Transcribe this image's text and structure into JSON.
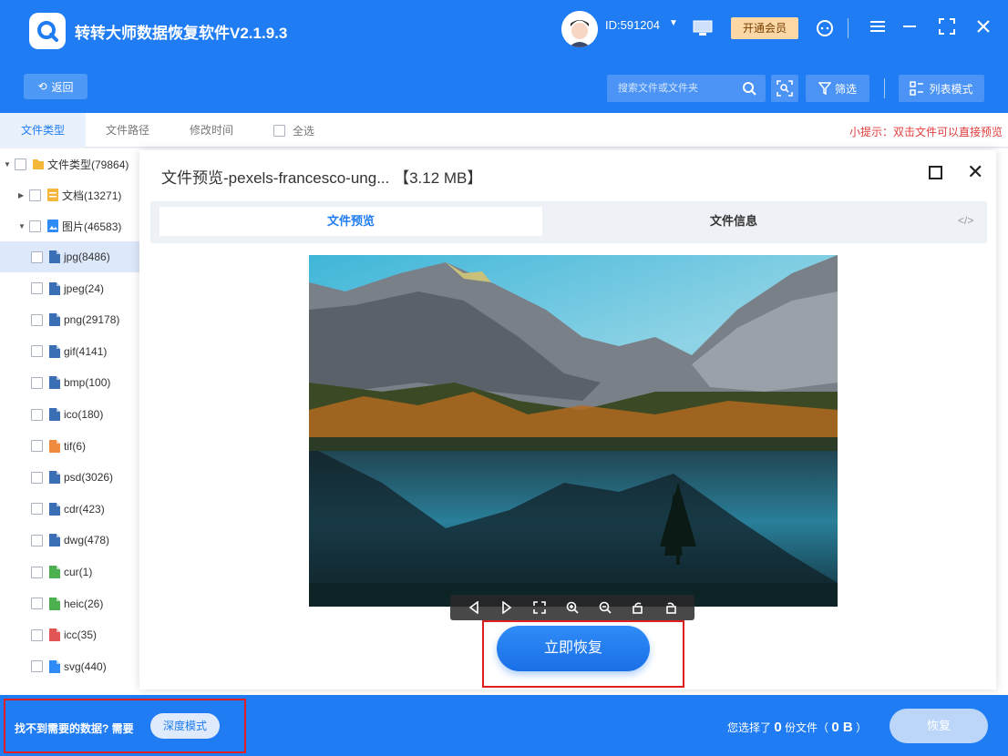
{
  "app": {
    "title": "转转大师数据恢复软件V2.1.9.3",
    "user_id": "ID:591204",
    "vip_label": "开通会员"
  },
  "toolbar": {
    "back_label": "返回",
    "search_placeholder": "搜索文件或文件夹",
    "filter_label": "筛选",
    "list_mode_label": "列表模式"
  },
  "tabs": [
    {
      "label": "文件类型"
    },
    {
      "label": "文件路径"
    },
    {
      "label": "修改时间"
    }
  ],
  "select_all_label": "全选",
  "tip": "小提示：双击文件可以直接预览",
  "tree": {
    "root": "文件类型(79864)",
    "docs": "文档(13271)",
    "images": "图片(46583)",
    "items": [
      {
        "label": "jpg(8486)",
        "icon": "image-file-icon"
      },
      {
        "label": "jpeg(24)",
        "icon": "image-file-icon"
      },
      {
        "label": "png(29178)",
        "icon": "image-file-icon"
      },
      {
        "label": "gif(4141)",
        "icon": "image-file-icon"
      },
      {
        "label": "bmp(100)",
        "icon": "image-file-icon"
      },
      {
        "label": "ico(180)",
        "icon": "image-file-icon"
      },
      {
        "label": "tif(6)",
        "icon": "tif-file-icon"
      },
      {
        "label": "psd(3026)",
        "icon": "image-file-icon"
      },
      {
        "label": "cdr(423)",
        "icon": "image-file-icon"
      },
      {
        "label": "dwg(478)",
        "icon": "image-file-icon"
      },
      {
        "label": "cur(1)",
        "icon": "cur-file-icon"
      },
      {
        "label": "heic(26)",
        "icon": "heic-file-icon"
      },
      {
        "label": "icc(35)",
        "icon": "icc-file-icon"
      },
      {
        "label": "svg(440)",
        "icon": "svg-file-icon"
      }
    ]
  },
  "modal": {
    "title": "文件预览-pexels-francesco-ung... 【3.12 MB】",
    "tab_preview": "文件预览",
    "tab_info": "文件信息",
    "code_label": "</>",
    "recover_label": "立即恢复"
  },
  "footer": {
    "hint": "找不到需要的数据? 需要",
    "deep_mode_label": "深度模式",
    "selected_prefix": "您选择了",
    "selected_count": "0",
    "selected_mid": "份文件（",
    "selected_size": "0 B",
    "selected_suffix": "）",
    "recover_label": "恢复"
  },
  "colors": {
    "brand": "#1f7cf2",
    "tip": "#e13c3c",
    "highlight": "#e02020"
  }
}
